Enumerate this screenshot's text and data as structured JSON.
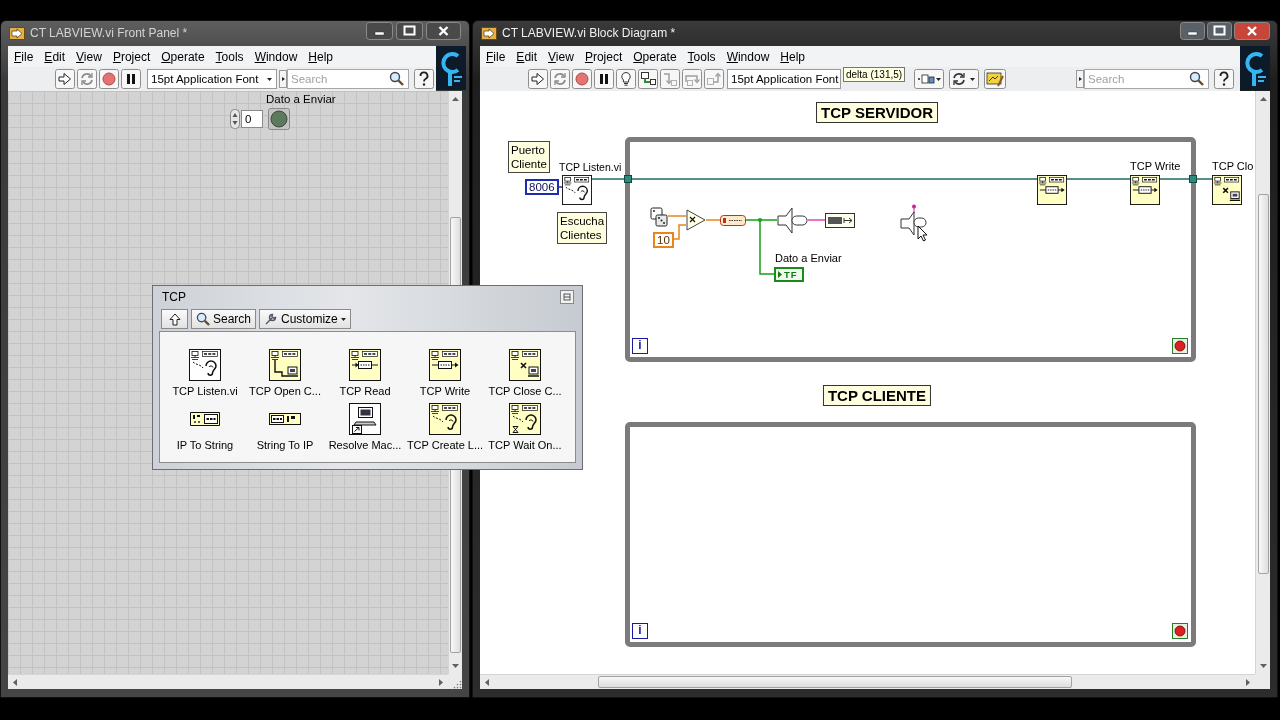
{
  "front_panel": {
    "title": "CT LABVIEW.vi Front Panel *",
    "menu": [
      "File",
      "Edit",
      "View",
      "Project",
      "Operate",
      "Tools",
      "Window",
      "Help"
    ],
    "toolbar": {
      "font": "15pt Application Font",
      "search": {
        "placeholder": "Search"
      }
    },
    "numeric": {
      "value": "0"
    },
    "led": {
      "label": "Dato a Enviar",
      "on": false
    }
  },
  "palette": {
    "title": "TCP",
    "buttons": [
      {
        "label": "Search",
        "kind": "search"
      },
      {
        "label": "Customize",
        "kind": "customize"
      }
    ],
    "items": [
      {
        "label": "TCP Listen.vi",
        "kind": "listen"
      },
      {
        "label": "TCP Open C...",
        "kind": "open"
      },
      {
        "label": "TCP Read",
        "kind": "read"
      },
      {
        "label": "TCP Write",
        "kind": "write"
      },
      {
        "label": "TCP Close C...",
        "kind": "close"
      },
      {
        "label": "IP To String",
        "kind": "ip_to_string"
      },
      {
        "label": "String To IP",
        "kind": "string_to_ip"
      },
      {
        "label": "Resolve Mac...",
        "kind": "resolve"
      },
      {
        "label": "TCP Create L...",
        "kind": "create_listener"
      },
      {
        "label": "TCP Wait On...",
        "kind": "wait_on_listener"
      }
    ]
  },
  "block_diagram": {
    "title": "CT LABVIEW.vi Block Diagram *",
    "menu": [
      "File",
      "Edit",
      "View",
      "Project",
      "Operate",
      "Tools",
      "Window",
      "Help"
    ],
    "toolbar": {
      "font": "15pt Application Font",
      "search": {
        "placeholder": "Search"
      },
      "tooltip": "delta (131,5)"
    },
    "loops": [
      {
        "title": "TCP SERVIDOR",
        "iteration": "i"
      },
      {
        "title": "TCP CLIENTE",
        "iteration": "i"
      }
    ],
    "free_labels": [
      "Puerto Cliente",
      "Escucha Clientes"
    ],
    "constants": [
      {
        "value": "8006",
        "kind": "integer"
      },
      {
        "value": "10",
        "kind": "float"
      }
    ],
    "tcp_nodes": [
      {
        "label": "TCP Listen.vi",
        "kind": "listen"
      },
      {
        "kind": "write"
      },
      {
        "label": "TCP Write",
        "kind": "write"
      },
      {
        "label": "TCP Clo",
        "kind": "close"
      }
    ],
    "indicator": {
      "label": "Dato a Enviar",
      "value": "TF"
    }
  }
}
